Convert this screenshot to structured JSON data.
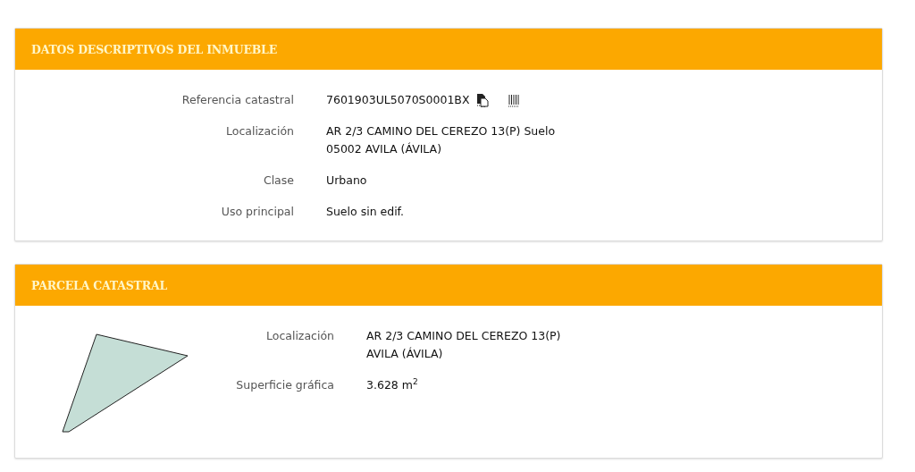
{
  "panels": [
    {
      "title": "DATOS DESCRIPTIVOS DEL INMUEBLE",
      "kind": "text",
      "rows": [
        {
          "label": "Referencia catastral",
          "lines": [
            "7601903UL5070S0001BX"
          ],
          "icons": true
        },
        {
          "label": "Localización",
          "lines": [
            "AR 2/3 CAMINO DEL CEREZO 13(P) Suelo",
            "05002 AVILA (ÁVILA)"
          ]
        },
        {
          "label": "Clase",
          "lines": [
            "Urbano"
          ]
        },
        {
          "label": "Uso principal",
          "lines": [
            "Suelo sin edif."
          ]
        }
      ]
    },
    {
      "title": "PARCELA CATASTRAL",
      "kind": "parcel",
      "rows": [
        {
          "label": "Localización",
          "lines": [
            "AR 2/3 CAMINO DEL CEREZO 13(P)",
            "AVILA (ÁVILA)"
          ]
        },
        {
          "label": "Superficie gráfica",
          "lines": [
            "3.628 m$^{2}$"
          ]
        }
      ]
    }
  ]
}
